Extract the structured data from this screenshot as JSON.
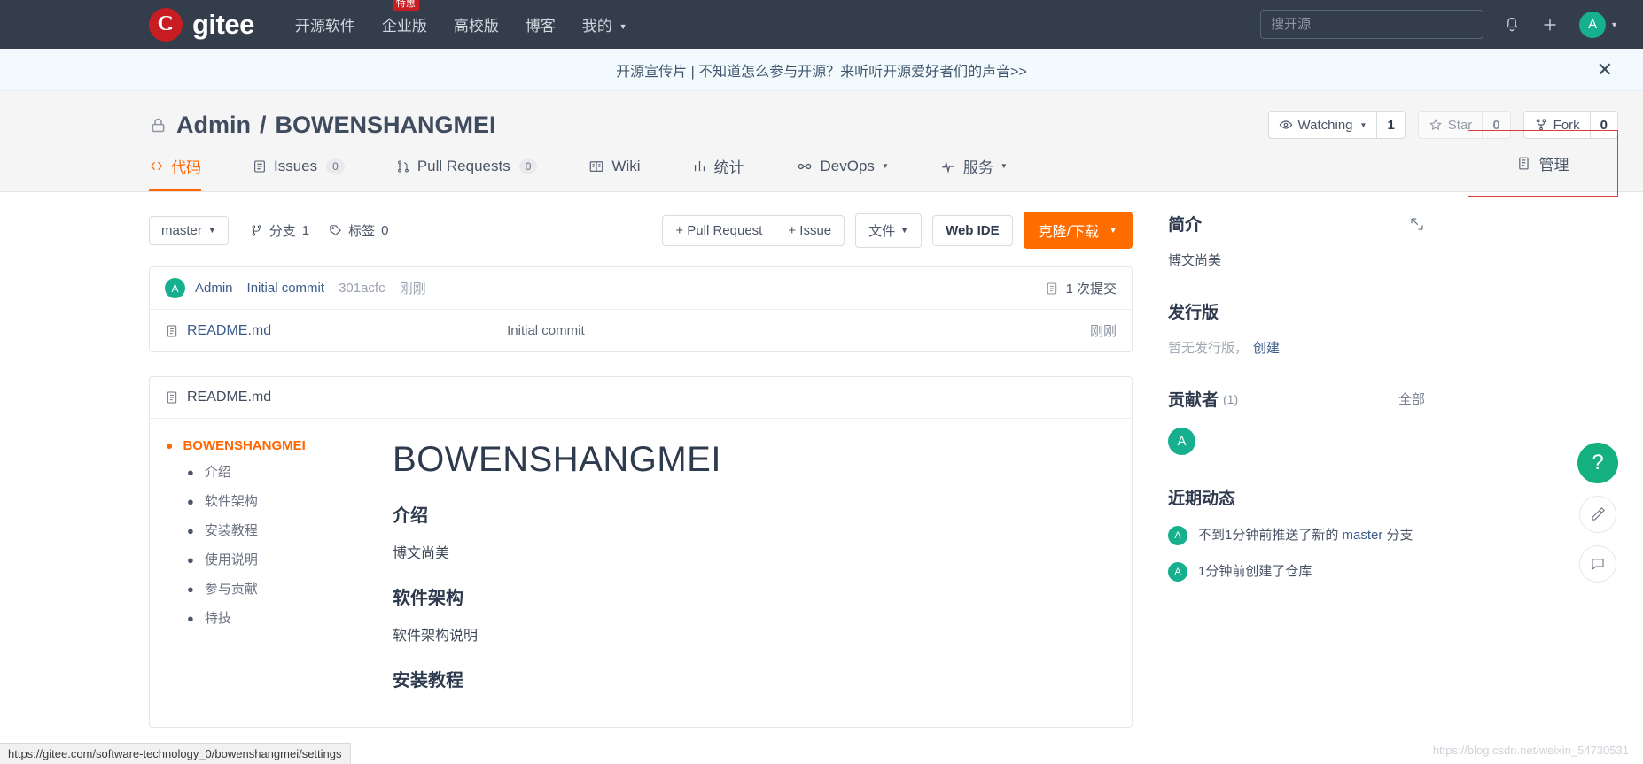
{
  "topnav": {
    "brand": "gitee",
    "items": [
      {
        "label": "开源软件",
        "caret": false,
        "badge": null
      },
      {
        "label": "企业版",
        "caret": false,
        "badge": "特惠"
      },
      {
        "label": "高校版",
        "caret": false,
        "badge": null
      },
      {
        "label": "博客",
        "caret": false,
        "badge": null
      },
      {
        "label": "我的",
        "caret": true,
        "badge": null
      }
    ],
    "search_placeholder": "搜开源",
    "search_value": "",
    "bell_icon": "bell-icon",
    "plus_icon": "plus-icon",
    "avatar_letter": "A"
  },
  "banner": {
    "text": "开源宣传片 | 不知道怎么参与开源？来听听开源爱好者们的声音>>",
    "close_icon": "close-icon"
  },
  "repo": {
    "lock_icon": "lock-icon",
    "owner": "Admin",
    "separator": "/",
    "name": "BOWENSHANGMEI",
    "actions": [
      {
        "name": "watching",
        "icon": "eye-icon",
        "label": "Watching",
        "caret": true,
        "count": "1",
        "dim": false
      },
      {
        "name": "star",
        "icon": "star-icon",
        "label": "Star",
        "caret": false,
        "count": "0",
        "dim": true
      },
      {
        "name": "fork",
        "icon": "fork-icon",
        "label": "Fork",
        "caret": false,
        "count": "0",
        "dim": false
      }
    ]
  },
  "tabs": [
    {
      "name": "code",
      "icon": "code-icon",
      "label": "代码",
      "count": null,
      "caret": false,
      "active": true
    },
    {
      "name": "issues",
      "icon": "issue-icon",
      "label": "Issues",
      "count": "0",
      "caret": false,
      "active": false
    },
    {
      "name": "pull-requests",
      "icon": "pr-icon",
      "label": "Pull Requests",
      "count": "0",
      "caret": false,
      "active": false
    },
    {
      "name": "wiki",
      "icon": "wiki-icon",
      "label": "Wiki",
      "count": null,
      "caret": false,
      "active": false
    },
    {
      "name": "stats",
      "icon": "chart-icon",
      "label": "统计",
      "count": null,
      "caret": false,
      "active": false
    },
    {
      "name": "devops",
      "icon": "infinity-icon",
      "label": "DevOps",
      "count": null,
      "caret": true,
      "active": false
    },
    {
      "name": "services",
      "icon": "pulse-icon",
      "label": "服务",
      "count": null,
      "caret": true,
      "active": false
    }
  ],
  "manage_tab": {
    "icon": "manage-icon",
    "label": "管理",
    "highlight_color": "#e23a3a"
  },
  "toolbar": {
    "branch": "master",
    "branches_icon": "branch-icon",
    "branches_label": "分支",
    "branches_count": "1",
    "tags_icon": "tag-icon",
    "tags_label": "标签",
    "tags_count": "0",
    "pull_request": "+ Pull Request",
    "issue": "+ Issue",
    "files": "文件",
    "web_ide": "Web IDE",
    "clone": "克隆/下载"
  },
  "commit": {
    "avatar_letter": "A",
    "author": "Admin",
    "message": "Initial commit",
    "sha": "301acfc",
    "time": "刚刚",
    "count_icon": "commit-icon",
    "count_label": "1 次提交"
  },
  "file": {
    "icon": "file-icon",
    "name": "README.md",
    "message": "Initial commit",
    "time": "刚刚"
  },
  "readme": {
    "header_icon": "file-icon",
    "header": "README.md",
    "toc": {
      "root": "BOWENSHANGMEI",
      "items": [
        "介绍",
        "软件架构",
        "安装教程",
        "使用说明",
        "参与贡献",
        "特技"
      ]
    },
    "content": {
      "h1": "BOWENSHANGMEI",
      "sections": [
        {
          "heading": "介绍",
          "body": "博文尚美"
        },
        {
          "heading": "软件架构",
          "body": "软件架构说明"
        },
        {
          "heading": "安装教程",
          "body": ""
        }
      ]
    }
  },
  "sidebar": {
    "intro": {
      "title": "简介",
      "edit_icon": "edit-icon",
      "text": "博文尚美"
    },
    "releases": {
      "title": "发行版",
      "empty_text": "暂无发行版，",
      "create_link": "创建"
    },
    "contributors": {
      "title": "贡献者",
      "count": "(1)",
      "all_link": "全部",
      "avatars": [
        "A"
      ]
    },
    "activity": {
      "title": "近期动态",
      "items": [
        {
          "avatar": "A",
          "prefix": "不到1分钟前推送了新的 ",
          "link": "master",
          "suffix": " 分支"
        },
        {
          "avatar": "A",
          "prefix": "1分钟前创建了仓库",
          "link": "",
          "suffix": ""
        }
      ]
    }
  },
  "floating": [
    {
      "name": "help-fab",
      "icon": "question-icon",
      "glyph": "?"
    },
    {
      "name": "feedback-fab",
      "icon": "pencil-icon",
      "glyph": ""
    },
    {
      "name": "chat-fab",
      "icon": "chat-icon",
      "glyph": ""
    }
  ],
  "statusbar": {
    "url": "https://gitee.com/software-technology_0/bowenshangmei/settings"
  },
  "watermark": "https://blog.csdn.net/weixin_54730531"
}
